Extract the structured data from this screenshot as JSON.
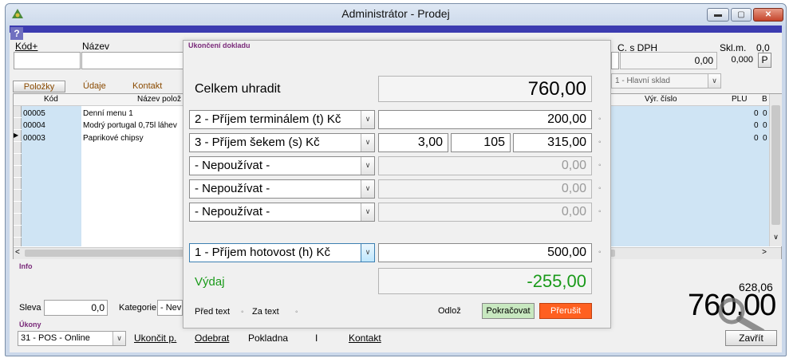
{
  "window": {
    "title": "Administrátor - Prodej",
    "help": "?"
  },
  "header": {
    "kod_label": "Kód+",
    "nazev_label": "Název",
    "c_s_dph_label": "C. s DPH",
    "c_s_dph_value": "0,00",
    "skl_m_label": "Skl.m.",
    "skl_m_top": "0,0",
    "skl_m_value": "0,000",
    "p_btn": "P"
  },
  "tabs": {
    "polozky": "Položky",
    "udaje": "Údaje",
    "kontakt": "Kontakt"
  },
  "sklad": "1 - Hlavní sklad",
  "grid": {
    "columns": {
      "kod": "Kód",
      "nazev": "Název polož",
      "vyr_cislo": "Výr. číslo",
      "plu": "PLU",
      "b": "B"
    },
    "rows": [
      {
        "kod": "00005",
        "nazev": "Denní menu 1",
        "plu": "0",
        "b": "0"
      },
      {
        "kod": "00004",
        "nazev": "Modrý portugal 0,75l láhev",
        "plu": "0",
        "b": "0"
      },
      {
        "kod": "00003",
        "nazev": "Paprikové chipsy",
        "plu": "0",
        "b": "0"
      }
    ]
  },
  "info_label": "Info",
  "sleva": {
    "label": "Sleva",
    "value": "0,0"
  },
  "kategorie": {
    "label": "Kategorie",
    "value": "- Nev"
  },
  "totals": {
    "small": "628,06",
    "big": "760,00"
  },
  "ukony": {
    "label": "Úkony",
    "select": "31 - POS - Online",
    "ukoncit": "Ukončit p.",
    "odebrat": "Odebrat",
    "pokladna": "Pokladna",
    "sep": "I",
    "kontakt": "Kontakt"
  },
  "zavrit": "Zavřít",
  "dialog": {
    "title": "Ukončení dokladu",
    "celkem_label": "Celkem uhradit",
    "celkem_value": "760,00",
    "payments": [
      {
        "type": "2 - Příjem terminálem (t) Kč",
        "value": "200,00"
      },
      {
        "type": "3 - Příjem šekem (s) Kč",
        "qty": "3,00",
        "price": "105",
        "value": "315,00"
      },
      {
        "type": "- Nepoužívat -",
        "value": "0,00"
      },
      {
        "type": "- Nepoužívat -",
        "value": "0,00"
      },
      {
        "type": "- Nepoužívat -",
        "value": "0,00"
      }
    ],
    "hotovost": {
      "type": "1 - Příjem hotovost (h) Kč",
      "value": "500,00"
    },
    "vydaj_label": "Výdaj",
    "vydaj_value": "-255,00",
    "pred_text": "Před text",
    "za_text": "Za text",
    "odloz": "Odlož",
    "pokracovat": "Pokračovat",
    "prerusit": "Přerušit"
  },
  "colors": {
    "accent_bar": "#3b3bb0",
    "vydaj_green": "#1a9a1a",
    "prerusit": "#ff6020",
    "pokracovat": "#c8e8c0"
  }
}
